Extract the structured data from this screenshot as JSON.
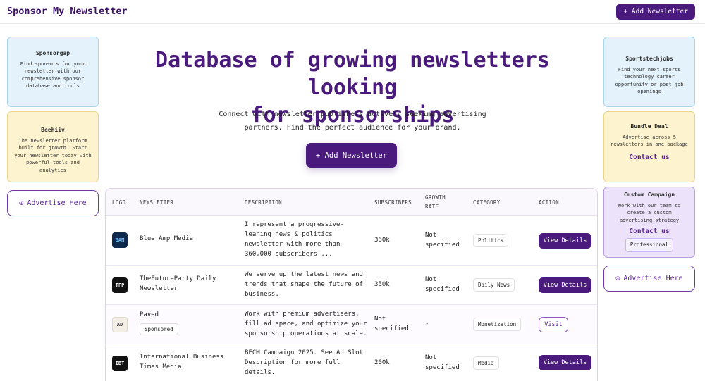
{
  "header": {
    "brand": "Sponsor My Newsletter",
    "add_label": "+ Add Newsletter"
  },
  "left_cards": [
    {
      "title": "Sponsorgap",
      "desc": "Find sponsors for your newsletter with our comprehensive sponsor database and tools"
    },
    {
      "title": "Beehiiv",
      "desc": "The newsletter platform built for growth. Start your newsletter today with powerful tools and analytics"
    }
  ],
  "left_advertise": {
    "icon": "megaphone-icon",
    "label": "Advertise Here"
  },
  "right_cards": [
    {
      "title": "Sportstechjobs",
      "desc": "Find your next sports technology career opportunity or post job openings"
    },
    {
      "title": "Bundle Deal",
      "desc": "Advertise across 5 newsletters in one package",
      "contact": "Contact us"
    },
    {
      "title": "Custom Campaign",
      "desc": "Work with our team to create a custom advertising strategy",
      "contact": "Contact us",
      "badge": "Professional"
    }
  ],
  "right_advertise": {
    "icon": "megaphone-icon",
    "label": "Advertise Here"
  },
  "hero": {
    "title_line1": "Database of growing newsletters looking",
    "title_line2": "for sponsorships",
    "sub_line1": "Connect with newsletter publishers actively seeking advertising",
    "sub_line2": "partners. Find the perfect audience for your brand.",
    "add_label": "+ Add Newsletter"
  },
  "table": {
    "headers": {
      "logo": "LOGO",
      "newsletter": "NEWSLETTER",
      "description": "DESCRIPTION",
      "subscribers": "SUBSCRIBERS",
      "growth_line1": "GROWTH",
      "growth_line2": "RATE",
      "category": "CATEGORY",
      "action": "ACTION"
    },
    "rows": [
      {
        "logo_text": "BAM",
        "name_line1": "Blue Amp Media",
        "name_line2": "",
        "desc": [
          "I represent a progressive-",
          "leaning news & politics",
          "newsletter with more than",
          "360,000 subscribers ..."
        ],
        "subscribers": "360k",
        "growth": [
          "Not",
          "specified"
        ],
        "category": "Politics",
        "action": "View Details"
      },
      {
        "logo_text": "TFP",
        "name_line1": "TheFutureParty Daily",
        "name_line2": "Newsletter",
        "desc": [
          "We serve up the latest news and",
          "trends that shape the future of",
          "business."
        ],
        "subscribers": "350k",
        "growth": [
          "Not",
          "specified"
        ],
        "category": "Daily News",
        "action": "View Details"
      },
      {
        "logo_text": "AD",
        "name_line1": "Paved",
        "badge": "Sponsored",
        "desc": [
          "Work with premium advertisers,",
          "fill ad space, and optimize your",
          "sponsorship operations at scale."
        ],
        "subscribers": [
          "Not",
          "specified"
        ],
        "growth": "-",
        "category": "Monetization",
        "action": "Visit"
      },
      {
        "logo_text": "IBT",
        "name_line1": "International Business",
        "name_line2": "Times Media",
        "desc": [
          "BFCM Campaign 2025. See Ad Slot",
          "Description for more full",
          "details."
        ],
        "subscribers": "200k",
        "growth": [
          "Not",
          "specified"
        ],
        "category": "Media",
        "action": "View Details"
      }
    ]
  }
}
